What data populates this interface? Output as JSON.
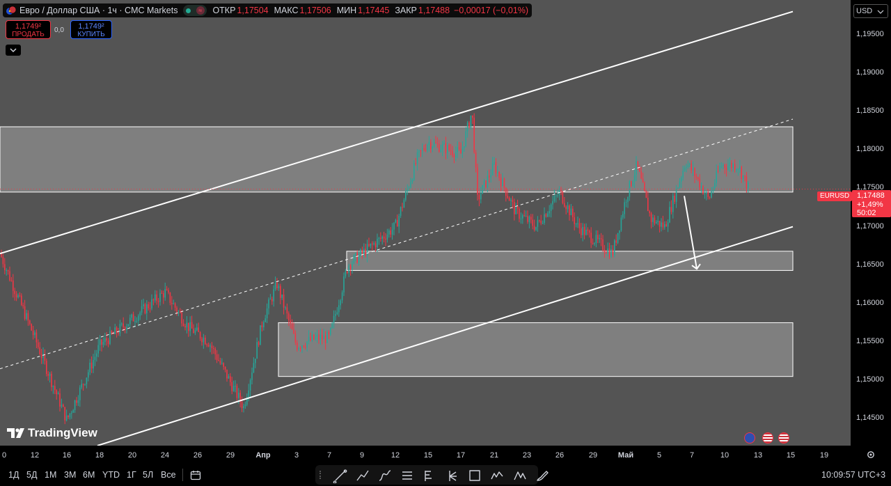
{
  "header": {
    "title": "Евро / Доллар США · 1ч · CMC Markets",
    "ohlc": [
      {
        "label": "ОТКР",
        "value": "1,17504"
      },
      {
        "label": "МАКС",
        "value": "1,17506"
      },
      {
        "label": "МИН",
        "value": "1,17445"
      },
      {
        "label": "ЗАКР",
        "value": "1,17488"
      }
    ],
    "change": "−0,00017 (−0,01%)"
  },
  "trade": {
    "sell_price": "1,1749²",
    "sell_label": "ПРОДАТЬ",
    "spread": "0,0",
    "buy_price": "1,1749²",
    "buy_label": "КУПИТЬ"
  },
  "currency": "USD",
  "price_label": {
    "symbol": "EURUSD",
    "price": "1,17488",
    "change_pct": "+1,49%",
    "countdown": "50:02"
  },
  "logo_text": "TradingView",
  "range_buttons": [
    "1Д",
    "5Д",
    "1М",
    "3М",
    "6М",
    "YTD",
    "1Г",
    "5Л",
    "Все"
  ],
  "time_display": "10:09:57 UTC+3",
  "icons": {
    "logo": "tradingview-logo-icon",
    "settings": "gear-icon",
    "goto_date": "calendar-range-icon",
    "tools": [
      "trend-line-icon",
      "polyline-icon",
      "path-icon",
      "parallel-channel-icon",
      "fib-retracement-icon",
      "pitchfork-icon",
      "rectangle-icon",
      "elliott-wave-icon",
      "pattern-icon",
      "brush-icon"
    ],
    "events": [
      "economic-event-icon",
      "us-flag-icon",
      "us-flag-icon"
    ]
  },
  "colors": {
    "plot_bg": "#545454",
    "up_candle": "#26a69a",
    "down_candle": "#f23645",
    "drawing": "#ffffff",
    "zone_fill": "rgba(255,255,255,0.25)"
  },
  "chart_data": {
    "type": "candlestick",
    "symbol": "EURUSD",
    "timeframe": "1h",
    "x_ticks": [
      "0",
      "12",
      "16",
      "18",
      "20",
      "24",
      "26",
      "29",
      "Апр",
      "3",
      "7",
      "9",
      "12",
      "15",
      "17",
      "21",
      "23",
      "26",
      "29",
      "Май",
      "5",
      "7",
      "10",
      "13",
      "15",
      "19"
    ],
    "y_ticks": [
      1.195,
      1.19,
      1.185,
      1.18,
      1.175,
      1.17,
      1.165,
      1.16,
      1.155,
      1.15,
      1.145
    ],
    "y_tick_labels": [
      "1,19500",
      "1,19000",
      "1,18500",
      "1,18000",
      "1,17500",
      "1,17000",
      "1,16500",
      "1,16000",
      "1,15500",
      "1,15000",
      "1,14500"
    ],
    "ylim": [
      1.1415,
      1.1995
    ],
    "last_price": 1.17488,
    "price_path": [
      {
        "x": "10",
        "y": 1.1665
      },
      {
        "x": "12",
        "y": 1.1555
      },
      {
        "x": "16",
        "y": 1.1448
      },
      {
        "x": "18",
        "y": 1.1545
      },
      {
        "x": "20",
        "y": 1.158
      },
      {
        "x": "24",
        "y": 1.1615
      },
      {
        "x": "26",
        "y": 1.157
      },
      {
        "x": "27",
        "y": 1.155
      },
      {
        "x": "29",
        "y": 1.1465
      },
      {
        "x": "Апр",
        "y": 1.158
      },
      {
        "x": "1",
        "y": 1.1625
      },
      {
        "x": "3",
        "y": 1.1545
      },
      {
        "x": "6",
        "y": 1.1555
      },
      {
        "x": "7",
        "y": 1.1555
      },
      {
        "x": "8",
        "y": 1.165
      },
      {
        "x": "9",
        "y": 1.1665
      },
      {
        "x": "11",
        "y": 1.1685
      },
      {
        "x": "12",
        "y": 1.17
      },
      {
        "x": "14",
        "y": 1.179
      },
      {
        "x": "15",
        "y": 1.181
      },
      {
        "x": "17",
        "y": 1.1795
      },
      {
        "x": "18",
        "y": 1.185
      },
      {
        "x": "18",
        "y": 1.1735
      },
      {
        "x": "21",
        "y": 1.178
      },
      {
        "x": "23",
        "y": 1.172
      },
      {
        "x": "24",
        "y": 1.17
      },
      {
        "x": "26",
        "y": 1.1745
      },
      {
        "x": "27",
        "y": 1.17
      },
      {
        "x": "29",
        "y": 1.1665
      },
      {
        "x": "30",
        "y": 1.174
      },
      {
        "x": "Май",
        "y": 1.178
      },
      {
        "x": "4",
        "y": 1.171
      },
      {
        "x": "5",
        "y": 1.17
      },
      {
        "x": "6",
        "y": 1.1785
      },
      {
        "x": "7",
        "y": 1.1765
      },
      {
        "x": "8",
        "y": 1.1735
      },
      {
        "x": "9",
        "y": 1.178
      },
      {
        "x": "11",
        "y": 1.178
      },
      {
        "x": "12",
        "y": 1.17488
      }
    ],
    "drawings": {
      "channel_upper": [
        {
          "x": "0",
          "y": 1.1665
        },
        {
          "x": "15",
          "y": 1.198
        }
      ],
      "channel_mid_dashed": [
        {
          "x": "0",
          "y": 1.1515
        },
        {
          "x": "15",
          "y": 1.184
        }
      ],
      "channel_lower": [
        {
          "x": "15",
          "y": 1.1415
        },
        {
          "x": "15",
          "y": 1.17
        }
      ],
      "zones": [
        {
          "from": "0",
          "to": "15",
          "top": 1.183,
          "bottom": 1.1745
        },
        {
          "from": "8",
          "to": "15",
          "top": 1.1668,
          "bottom": 1.1643
        },
        {
          "from": "2",
          "to": "15",
          "top": 1.1575,
          "bottom": 1.1505
        }
      ],
      "arrow": [
        {
          "x": "6",
          "y": 1.174
        },
        {
          "x": "7",
          "y": 1.1645
        }
      ]
    }
  }
}
